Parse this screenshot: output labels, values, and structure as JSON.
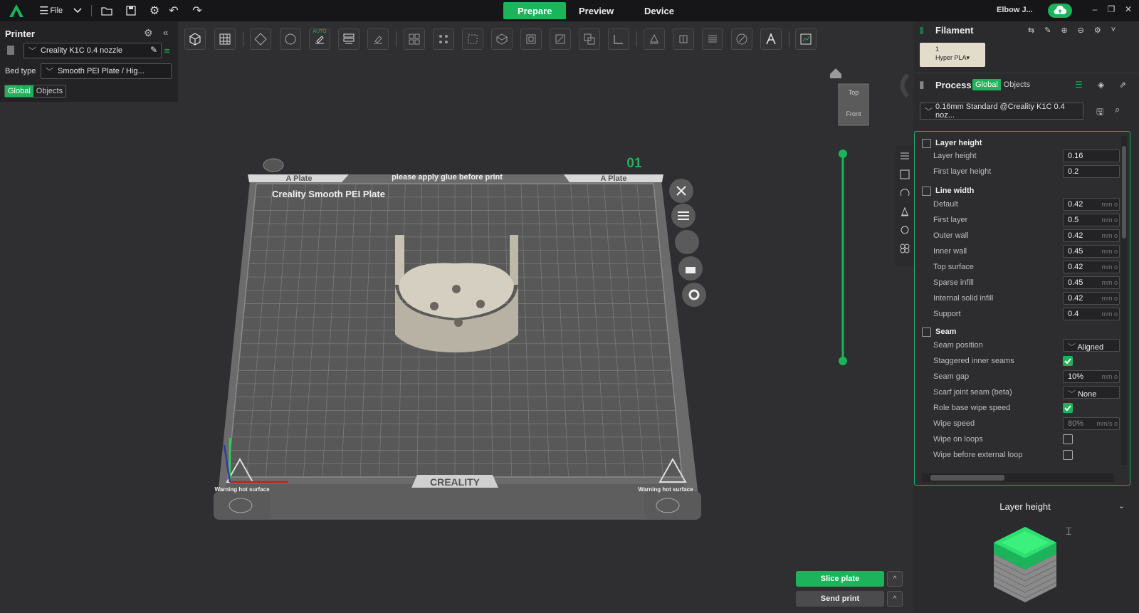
{
  "topbar": {
    "file_label": "File",
    "tabs": [
      {
        "label": "Prepare",
        "active": true
      },
      {
        "label": "Preview",
        "active": false
      },
      {
        "label": "Device",
        "active": false
      }
    ],
    "user": "Elbow J..."
  },
  "printer": {
    "title": "Printer",
    "printer_name": "Creality K1C 0.4 nozzle",
    "bed_type_label": "Bed type",
    "bed_type_value": "Smooth PEI Plate / Hig...",
    "scope_global": "Global",
    "scope_objects": "Objects"
  },
  "plate": {
    "number": "01",
    "left_tab": "A Plate",
    "right_tab": "A Plate",
    "notice": "please apply glue before print",
    "name": "Creality Smooth PEI Plate",
    "brand": "CREALITY",
    "warning": "Warning hot surface",
    "auto_label": "AUTO"
  },
  "nav_cube": {
    "top": "Top",
    "front": "Front"
  },
  "filament": {
    "title": "Filament",
    "slot_number": "1",
    "slot_name": "Hyper PLA▾",
    "slot_color": "#e3dccb"
  },
  "process": {
    "title": "Process",
    "scope_global": "Global",
    "scope_objects": "Objects",
    "preset": "0.16mm Standard @Creality K1C 0.4 noz..."
  },
  "groups": {
    "layer_height": "Layer height",
    "line_width": "Line width",
    "seam": "Seam"
  },
  "settings": [
    {
      "label": "Layer height",
      "value": "0.16",
      "unit": ""
    },
    {
      "label": "First layer height",
      "value": "0.2",
      "unit": ""
    },
    {
      "label": "Default",
      "value": "0.42",
      "unit": "mm o"
    },
    {
      "label": "First layer",
      "value": "0.5",
      "unit": "mm o"
    },
    {
      "label": "Outer wall",
      "value": "0.42",
      "unit": "mm o"
    },
    {
      "label": "Inner wall",
      "value": "0.45",
      "unit": "mm o"
    },
    {
      "label": "Top surface",
      "value": "0.42",
      "unit": "mm o"
    },
    {
      "label": "Sparse infill",
      "value": "0.45",
      "unit": "mm o"
    },
    {
      "label": "Internal solid infill",
      "value": "0.42",
      "unit": "mm o"
    },
    {
      "label": "Support",
      "value": "0.4",
      "unit": "mm o"
    },
    {
      "label": "Seam position",
      "value": "Aligned",
      "unit": ""
    },
    {
      "label": "Staggered inner seams",
      "value": "",
      "unit": ""
    },
    {
      "label": "Seam gap",
      "value": "10%",
      "unit": "mm o"
    },
    {
      "label": "Scarf joint seam (beta)",
      "value": "None",
      "unit": ""
    },
    {
      "label": "Role base wipe speed",
      "value": "",
      "unit": ""
    },
    {
      "label": "Wipe speed",
      "value": "80%",
      "unit": "mm/s o"
    },
    {
      "label": "Wipe on loops",
      "value": "",
      "unit": ""
    },
    {
      "label": "Wipe before external loop",
      "value": "",
      "unit": ""
    }
  ],
  "checks": {
    "staggered": true,
    "role_wipe": true,
    "wipe_loops": false,
    "wipe_ext": false
  },
  "preview_box": {
    "title": "Layer height"
  },
  "actions": {
    "slice": "Slice plate",
    "send": "Send print",
    "caret": "^"
  },
  "colors": {
    "accent": "#1cb35b"
  }
}
